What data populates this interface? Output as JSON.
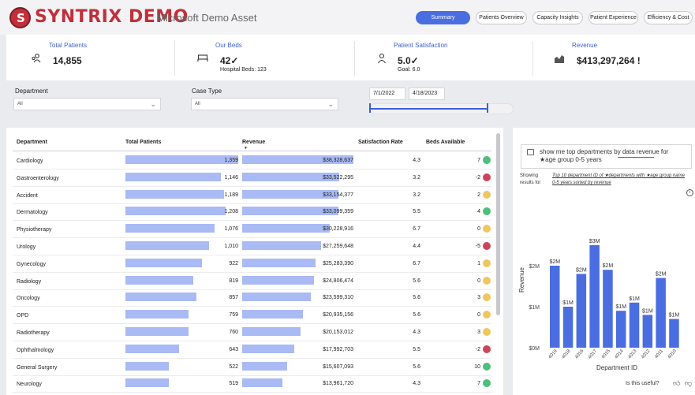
{
  "header": {
    "brand": "SYNTRIX DEMO",
    "subtitle": "Microsoft Demo Asset",
    "tabs": [
      {
        "label": "Summary",
        "active": true
      },
      {
        "label": "Patients Overview",
        "active": false
      },
      {
        "label": "Capacity Insights",
        "active": false
      },
      {
        "label": "Patient Experience",
        "active": false
      },
      {
        "label": "Efficiency & Cost",
        "active": false
      }
    ]
  },
  "kpis": [
    {
      "label": "Total Patients",
      "value": "14,855",
      "sub": "",
      "icon": "patients-icon"
    },
    {
      "label": "Our Beds",
      "value": "42✓",
      "sub": "Hospital Beds: 123",
      "icon": "bed-icon"
    },
    {
      "label": "Patient Satisfaction",
      "value": "5.0✓",
      "sub": "Goal: 6.0",
      "icon": "person-icon"
    },
    {
      "label": "Revenue",
      "value": "$413,297,264 !",
      "sub": "",
      "icon": "revenue-icon"
    }
  ],
  "filters": {
    "department_label": "Department",
    "department_value": "All",
    "case_type_label": "Case Type",
    "case_type_value": "All",
    "date_start": "7/1/2022",
    "date_end": "4/18/2023"
  },
  "table": {
    "headers": [
      "Department",
      "Total Patients",
      "Revenue",
      "Satisfaction Rate",
      "Beds Available"
    ],
    "rows": [
      {
        "dept": "Cardiology",
        "patients": "1,359",
        "revenue": "$38,328,637",
        "sat": "4.3",
        "beds": "7",
        "status": "green"
      },
      {
        "dept": "Gastroenterology",
        "patients": "1,146",
        "revenue": "$33,522,295",
        "sat": "3.2",
        "beds": "-2",
        "status": "red"
      },
      {
        "dept": "Accident",
        "patients": "1,189",
        "revenue": "$33,154,377",
        "sat": "3.2",
        "beds": "2",
        "status": "yellow"
      },
      {
        "dept": "Dermatology",
        "patients": "1,208",
        "revenue": "$33,099,359",
        "sat": "5.5",
        "beds": "4",
        "status": "green"
      },
      {
        "dept": "Physiotherapy",
        "patients": "1,076",
        "revenue": "$30,228,916",
        "sat": "6.7",
        "beds": "0",
        "status": "yellow"
      },
      {
        "dept": "Urology",
        "patients": "1,010",
        "revenue": "$27,259,648",
        "sat": "4.4",
        "beds": "-5",
        "status": "red"
      },
      {
        "dept": "Gynecology",
        "patients": "922",
        "revenue": "$25,283,390",
        "sat": "6.7",
        "beds": "1",
        "status": "yellow"
      },
      {
        "dept": "Radiology",
        "patients": "819",
        "revenue": "$24,806,474",
        "sat": "5.6",
        "beds": "0",
        "status": "yellow"
      },
      {
        "dept": "Oncology",
        "patients": "857",
        "revenue": "$23,599,310",
        "sat": "5.6",
        "beds": "3",
        "status": "yellow"
      },
      {
        "dept": "OPD",
        "patients": "759",
        "revenue": "$20,935,156",
        "sat": "5.6",
        "beds": "0",
        "status": "yellow"
      },
      {
        "dept": "Radiotherapy",
        "patients": "760",
        "revenue": "$20,153,012",
        "sat": "4.3",
        "beds": "3",
        "status": "yellow"
      },
      {
        "dept": "Ophthalmology",
        "patients": "643",
        "revenue": "$17,992,703",
        "sat": "5.5",
        "beds": "-2",
        "status": "red"
      },
      {
        "dept": "General Surgery",
        "patients": "522",
        "revenue": "$15,607,093",
        "sat": "5.6",
        "beds": "10",
        "status": "green"
      },
      {
        "dept": "Neurology",
        "patients": "519",
        "revenue": "$13,961,720",
        "sat": "4.3",
        "beds": "7",
        "status": "green"
      }
    ]
  },
  "qa": {
    "question": "show me top departments by data revenue for ★age group 0-5 years",
    "showing_label": "Showing results for",
    "showing_text": "Top 10 department ID of ★departments with ★age group name 0-5 years sorted by revenue",
    "useful_label": "Is this useful?"
  },
  "colors": {
    "accent": "#3b5fd6",
    "brand": "#c22f3a",
    "bar_fill": "#a9baf4",
    "chart_bar": "#4a6ee0",
    "status_green": "#4cbf7a",
    "status_yellow": "#efc75e",
    "status_red": "#cc4459"
  },
  "chart_data": {
    "type": "bar",
    "categories": [
      "4019",
      "4018",
      "4016",
      "4017",
      "4015",
      "4014",
      "4013",
      "4012",
      "4011",
      "4010"
    ],
    "values": [
      2.0,
      1.0,
      1.8,
      2.5,
      1.9,
      0.9,
      1.1,
      0.8,
      1.7,
      0.7
    ],
    "data_labels": [
      "$2M",
      "$1M",
      "$2M",
      "$3M",
      "$2M",
      "$1M",
      "$1M",
      "$1M",
      "$2M",
      "$1M"
    ],
    "xlabel": "Department ID",
    "ylabel": "Revenue",
    "yticks": [
      "$0M",
      "$1M",
      "$2M"
    ],
    "ylim": [
      0,
      3
    ]
  }
}
